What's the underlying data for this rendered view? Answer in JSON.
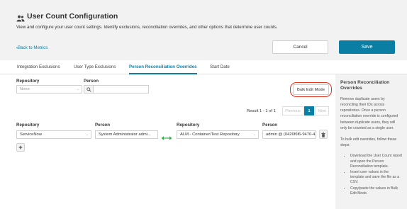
{
  "page": {
    "title": "User Count Configuration",
    "subtitle": "View and configure your user count settings. Identify exclusions, reconciliation overrides, and other options that determine user counts.",
    "back_link": "Back to Metrics",
    "cancel_label": "Cancel",
    "save_label": "Save"
  },
  "tabs": [
    {
      "label": "Integration Exclusions",
      "active": false
    },
    {
      "label": "User Type Exclusions",
      "active": false
    },
    {
      "label": "Person Reconciliation Overrides",
      "active": true
    },
    {
      "label": "Start Date",
      "active": false
    }
  ],
  "filters": {
    "repository_label": "Repository",
    "repository_placeholder": "None",
    "person_label": "Person",
    "person_value": ""
  },
  "bulk_edit_label": "Bulk Edit Mode",
  "results": {
    "text": "Result 1 - 1 of 1",
    "previous": "Previous",
    "page": "1",
    "next": "Next"
  },
  "override_headers": {
    "repository": "Repository",
    "person": "Person",
    "repository2": "Repository",
    "person2": "Person"
  },
  "override_row": {
    "repository": "ServiceNow",
    "person": "System Administrator admi...",
    "repository2": "ALM - Container/Test Repository",
    "person2": "admin @ (0426f6f6-9470-4..."
  },
  "add_label": "+",
  "side_panel": {
    "title": "Person Reconciliation Overrides",
    "paragraph1": "Remove duplicate users by reconciling their IDs across repositories. Once a person reconciliation override is configured between duplicate users, they will only be counted as a single user.",
    "paragraph2": "To bulk edit overrides, follow these steps:",
    "steps": [
      "Download the User Count report and open the Person Reconciliation template.",
      "Insert user values in the template and save the file as a CSV.",
      "Copy/paste the values in Bulk Edit Mode."
    ]
  },
  "colors": {
    "accent": "#0a7fa3",
    "link_arrow": "#36b24a",
    "highlight_ring": "#e0341e",
    "header_bg": "#f2f2f2"
  },
  "icons": {
    "title": "users-icon",
    "back": "chevron-left-icon",
    "search": "search-icon",
    "link": "double-arrow-icon",
    "delete": "trash-icon",
    "add": "plus-icon"
  }
}
